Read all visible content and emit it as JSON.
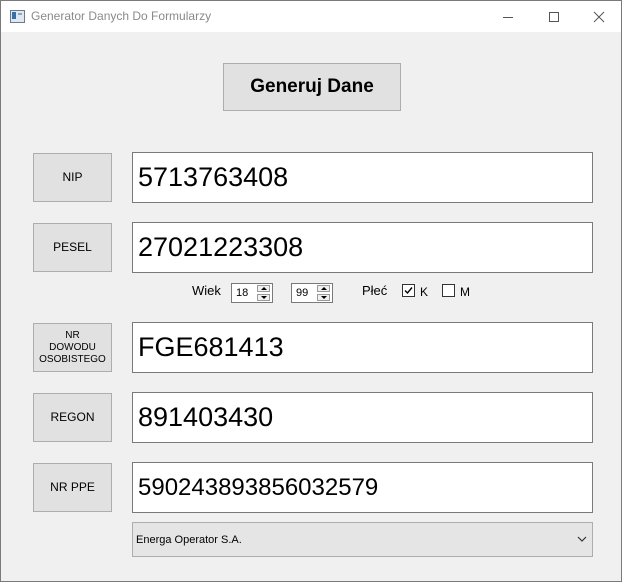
{
  "window": {
    "title": "Generator Danych Do Formularzy"
  },
  "icons": {
    "app": "app-window-icon",
    "minimize": "minimize-icon",
    "maximize": "maximize-icon",
    "close": "close-icon",
    "check": "checkmark-icon",
    "dropdown": "chevron-down-icon"
  },
  "generate_button": {
    "label": "Generuj Dane"
  },
  "rows": [
    {
      "button": "NIP",
      "value": "5713763408"
    },
    {
      "button": "PESEL",
      "value": "27021223308"
    },
    {
      "button_lines": [
        "NR",
        "DOWODU",
        "OSOBISTEGO"
      ],
      "value": "FGE681413"
    },
    {
      "button": "REGON",
      "value": "891403430"
    },
    {
      "button": "NR PPE",
      "value": "590243893856032579"
    }
  ],
  "age": {
    "label": "Wiek",
    "min": "18",
    "max": "99"
  },
  "gender": {
    "label": "Płeć",
    "options": [
      {
        "label": "K",
        "checked": true
      },
      {
        "label": "M",
        "checked": false
      }
    ]
  },
  "operator": {
    "selected": "Energa Operator S.A."
  },
  "colors": {
    "background": "#f0f0f0",
    "button_face": "#e1e1e1",
    "title_text": "#8a8a8a"
  }
}
